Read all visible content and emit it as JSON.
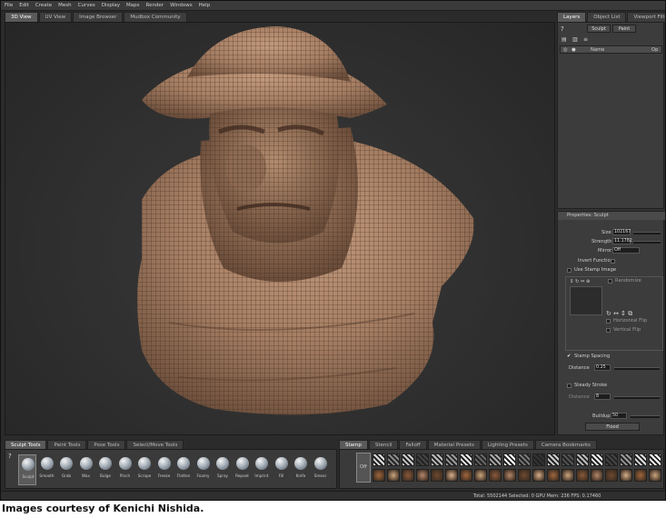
{
  "menu": [
    "File",
    "Edit",
    "Create",
    "Mesh",
    "Curves",
    "Display",
    "Maps",
    "Render",
    "Windows",
    "Help"
  ],
  "view_tabs": [
    {
      "label": "3D View",
      "active": true
    },
    {
      "label": "UV View",
      "active": false
    },
    {
      "label": "Image Browser",
      "active": false
    },
    {
      "label": "Mudbox Community",
      "active": false
    }
  ],
  "right_tabs": [
    {
      "label": "Layers",
      "active": true
    },
    {
      "label": "Object List",
      "active": false
    },
    {
      "label": "Viewport Filters",
      "active": false
    }
  ],
  "layers": {
    "sculpt_btn": "Sculpt",
    "paint_btn": "Paint",
    "col_name": "Name",
    "col_op": "Op"
  },
  "properties": {
    "title": "Properties: Sculpt",
    "size_label": "Size",
    "size_value": "102167",
    "strength_label": "Strength",
    "strength_value": "11.1782",
    "mirror_label": "Mirror",
    "mirror_value": "Off",
    "invert_label": "Invert Function",
    "use_stamp_label": "Use Stamp Image",
    "randomize_label": "Randomize",
    "hflip_label": "Horizontal Flip",
    "vflip_label": "Vertical Flip",
    "stamp_spacing_label": "Stamp Spacing",
    "distance_label": "Distance",
    "distance_value": "0.25",
    "steady_label": "Steady Stroke",
    "steady_distance_label": "Distance",
    "steady_distance_value": "8",
    "buildup_label": "Buildup",
    "buildup_value": "50",
    "flood_btn": "Flood"
  },
  "tool_tabs": [
    {
      "label": "Sculpt Tools",
      "active": true
    },
    {
      "label": "Paint Tools",
      "active": false
    },
    {
      "label": "Pose Tools",
      "active": false
    },
    {
      "label": "Select/Move Tools",
      "active": false
    }
  ],
  "tools": [
    "Sculpt",
    "Smooth",
    "Grab",
    "Wax",
    "Bulge",
    "Pinch",
    "Scrape",
    "Freeze",
    "Flatten",
    "Foamy",
    "Spray",
    "Repeat",
    "Imprint",
    "Fill",
    "Knife",
    "Smear"
  ],
  "stamp_tabs": [
    {
      "label": "Stamp",
      "active": true
    },
    {
      "label": "Stencil",
      "active": false
    },
    {
      "label": "Falloff",
      "active": false
    },
    {
      "label": "Material Presets",
      "active": false
    },
    {
      "label": "Lighting Presets",
      "active": false
    },
    {
      "label": "Camera Bookmarks",
      "active": false
    }
  ],
  "stamp_off_label": "Off",
  "status": "Total: 5502144   Selected: 0   GPU Mem: 236   FPS: 0.17460",
  "caption": "Images courtesy of Kenichi Nishida.",
  "colors": {
    "mesh": "#a57d62",
    "background": "#2b2b2b",
    "panel": "#333333"
  }
}
